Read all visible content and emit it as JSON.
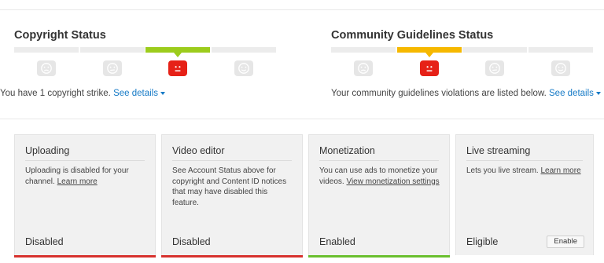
{
  "colors": {
    "active_red": "#e62117",
    "green": "#9ccc1c",
    "yellow": "#f6b800",
    "inactive_face": "#e6e6e6",
    "bar_gray": "#ececec",
    "link": "#167ac6",
    "strip_red": "#d7322e",
    "strip_green": "#6abf2e"
  },
  "copyright": {
    "title": "Copyright Status",
    "faces": [
      {
        "icon": "sad-face-icon",
        "active": false
      },
      {
        "icon": "meh-face-icon",
        "active": false
      },
      {
        "icon": "frown-face-icon",
        "active": true
      },
      {
        "icon": "happy-face-icon",
        "active": false
      }
    ],
    "highlighted_segment": 3,
    "highlight_color": "#9ccc1c",
    "note": "You have 1 copyright strike.",
    "link_label": "See details"
  },
  "community": {
    "title": "Community Guidelines Status",
    "faces": [
      {
        "icon": "sad-face-icon",
        "active": false
      },
      {
        "icon": "frown-face-icon",
        "active": true
      },
      {
        "icon": "meh-face-icon",
        "active": false
      },
      {
        "icon": "happy-face-icon",
        "active": false
      }
    ],
    "highlighted_segment": 2,
    "highlight_color": "#f6b800",
    "note": "Your community guidelines violations are listed below.",
    "link_label": "See details"
  },
  "cards": [
    {
      "title": "Uploading",
      "desc": "Uploading is disabled for your channel.",
      "link": "Learn more",
      "status": "Disabled",
      "strip": "#d7322e"
    },
    {
      "title": "Video editor",
      "desc": "See Account Status above for copyright and Content ID notices that may have disabled this feature.",
      "link": "",
      "status": "Disabled",
      "strip": "#d7322e"
    },
    {
      "title": "Monetization",
      "desc": "You can use ads to monetize your videos.",
      "link": "View monetization settings",
      "status": "Enabled",
      "strip": "#6abf2e"
    },
    {
      "title": "Live streaming",
      "desc": "Lets you live stream.",
      "link": "Learn more",
      "status": "Eligible",
      "strip": "",
      "button": "Enable"
    }
  ]
}
